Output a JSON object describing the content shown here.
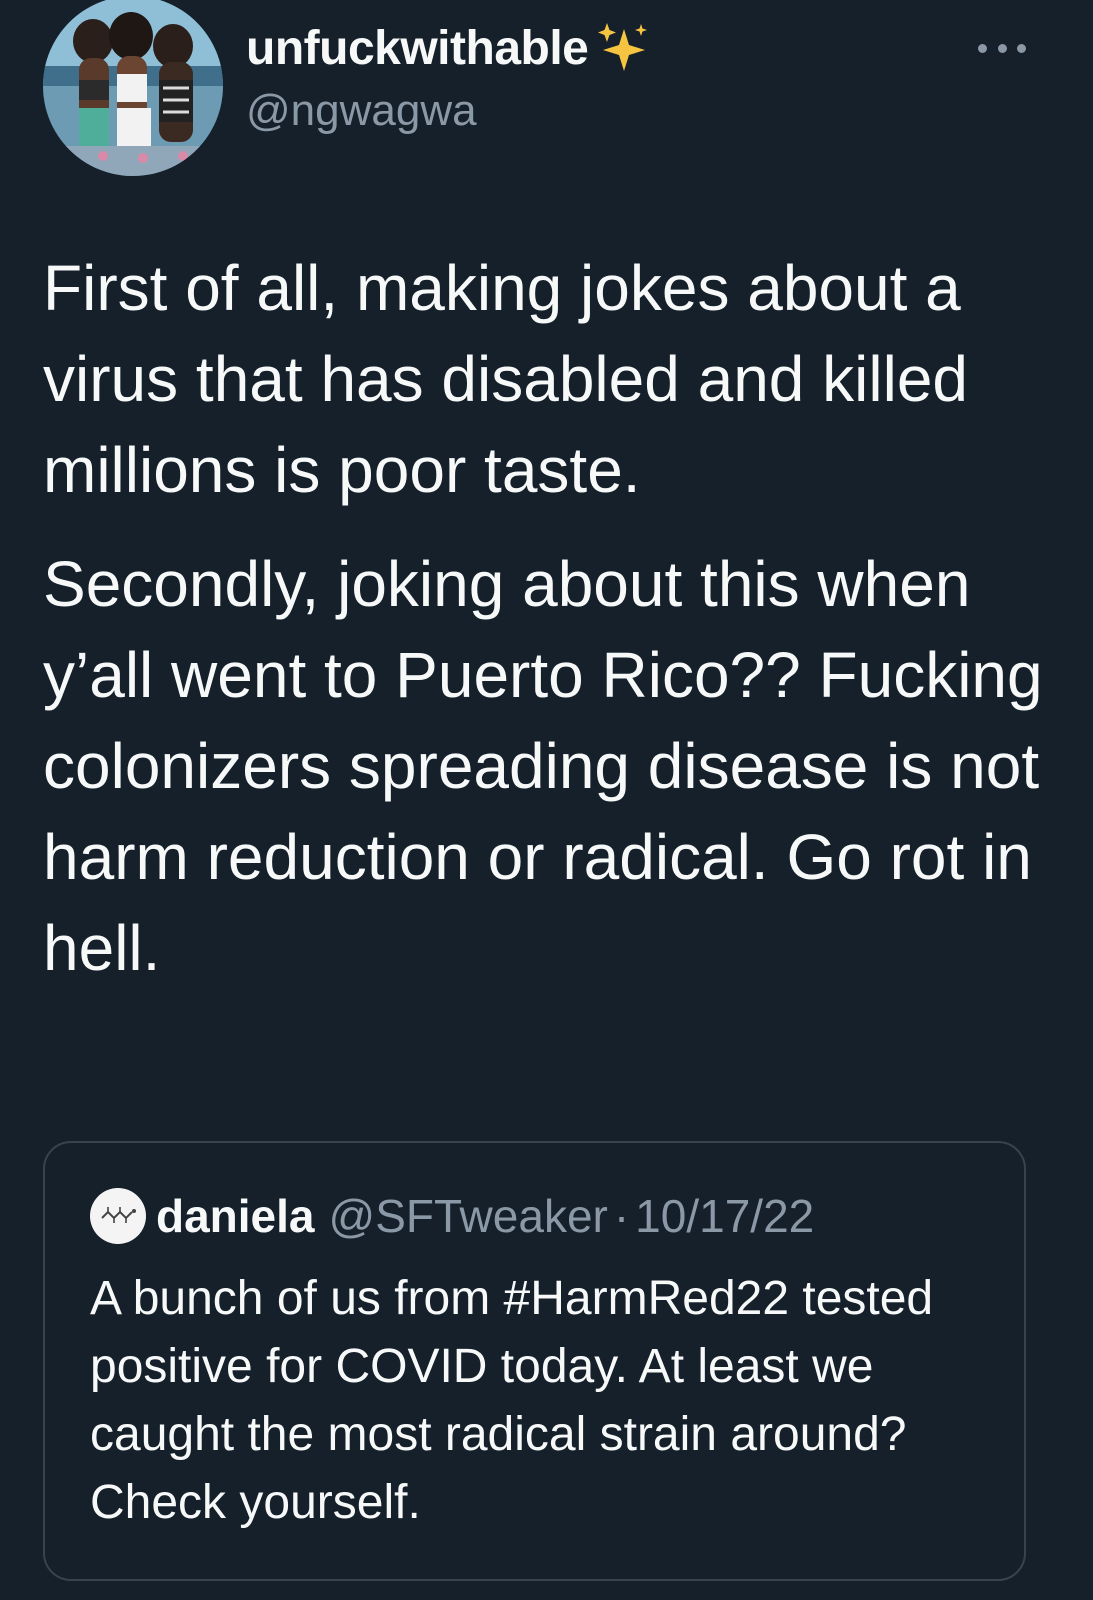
{
  "tweet": {
    "display_name": "unfuckwithable",
    "handle": "@ngwagwa",
    "paragraphs": [
      "First of all, making jokes about a virus that has disabled and killed millions is poor taste.",
      "Secondly, joking about this when y’all went to Puerto Rico?? Fucking colonizers spreading disease is not harm reduction or radical. Go rot in hell."
    ],
    "icons": {
      "name_badge": "sparkles-icon",
      "menu": "more-icon"
    }
  },
  "quote": {
    "display_name": "daniela",
    "handle": "@SFTweaker",
    "separator": "·",
    "date": "10/17/22",
    "text": "A bunch of us from #HarmRed22 tested positive for COVID today. At least we caught the most radical strain around? Check yourself."
  },
  "colors": {
    "background": "#15202b",
    "primary_text": "#f7f9f9",
    "secondary_text": "#8b98a5",
    "border": "#38444d",
    "sparkle": "#f5c542"
  }
}
